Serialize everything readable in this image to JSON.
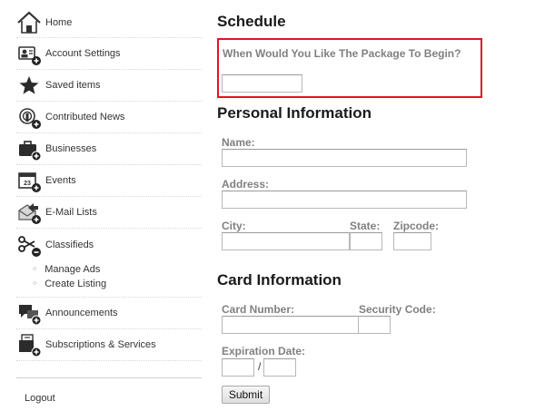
{
  "sidebar": {
    "items": [
      {
        "label": "Home",
        "icon": "home-icon"
      },
      {
        "label": "Account Settings",
        "icon": "account-settings-icon"
      },
      {
        "label": "Saved items",
        "icon": "star-icon"
      },
      {
        "label": "Contributed News",
        "icon": "news-icon"
      },
      {
        "label": "Businesses",
        "icon": "briefcase-icon"
      },
      {
        "label": "Events",
        "icon": "calendar-icon"
      },
      {
        "label": "E-Mail Lists",
        "icon": "email-icon"
      },
      {
        "label": "Classifieds",
        "icon": "scissors-icon"
      }
    ],
    "classifieds_sub": [
      "Manage Ads",
      "Create Listing"
    ],
    "more_items": [
      {
        "label": "Announcements",
        "icon": "announcement-icon"
      },
      {
        "label": "Subscriptions & Services",
        "icon": "subscriptions-icon"
      }
    ],
    "logout": "Logout"
  },
  "schedule": {
    "title": "Schedule",
    "question": "When Would You Like The Package To Begin?",
    "start_value": "",
    "highlight_color": "#e3151d"
  },
  "personal": {
    "title": "Personal Information",
    "name_label": "Name:",
    "address_label": "Address:",
    "city_label": "City:",
    "state_label": "State:",
    "zip_label": "Zipcode:",
    "name_value": "",
    "address_value": "",
    "city_value": "",
    "state_value": "",
    "zip_value": ""
  },
  "card": {
    "title": "Card Information",
    "number_label": "Card Number:",
    "security_label": "Security Code:",
    "expiration_label": "Expiration Date:",
    "separator": "/",
    "number_value": "",
    "security_value": "",
    "exp_month_value": "",
    "exp_year_value": ""
  },
  "submit_label": "Submit"
}
